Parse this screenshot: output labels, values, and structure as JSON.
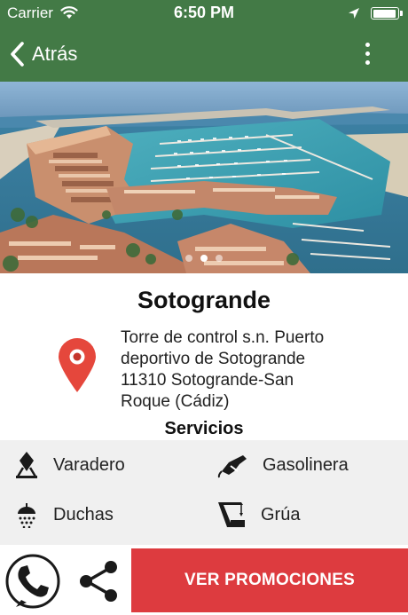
{
  "status_bar": {
    "carrier": "Carrier",
    "time": "6:50 PM",
    "battery_level": 0.95,
    "icons": [
      "wifi-icon",
      "location-arrow-icon",
      "battery-icon"
    ]
  },
  "nav": {
    "back_label": "Atrás",
    "more_icon": "more-vertical-icon"
  },
  "gallery": {
    "image": "aerial marina photo",
    "page_count": 3,
    "current_page": 2
  },
  "place": {
    "title": "Sotogrande",
    "address_lines": [
      "Torre de control s.n. Puerto",
      "deportivo de Sotogrande",
      "11310 Sotogrande-San",
      "Roque (Cádiz)"
    ],
    "pin_icon": "map-pin-icon"
  },
  "services": {
    "heading": "Servicios",
    "items": [
      {
        "label": "Varadero",
        "icon": "boat-lift-icon"
      },
      {
        "label": "Gasolinera",
        "icon": "fuel-nozzle-icon"
      },
      {
        "label": "Duchas",
        "icon": "shower-icon"
      },
      {
        "label": "Grúa",
        "icon": "crane-icon"
      }
    ]
  },
  "actions": {
    "call_icon": "phone-icon",
    "share_icon": "share-icon",
    "promo_label": "VER PROMOCIONES"
  },
  "colors": {
    "header_green": "#437a46",
    "promo_red": "#dd3b3f",
    "pin_red": "#e5473c",
    "services_bg": "#f0f0f0"
  }
}
